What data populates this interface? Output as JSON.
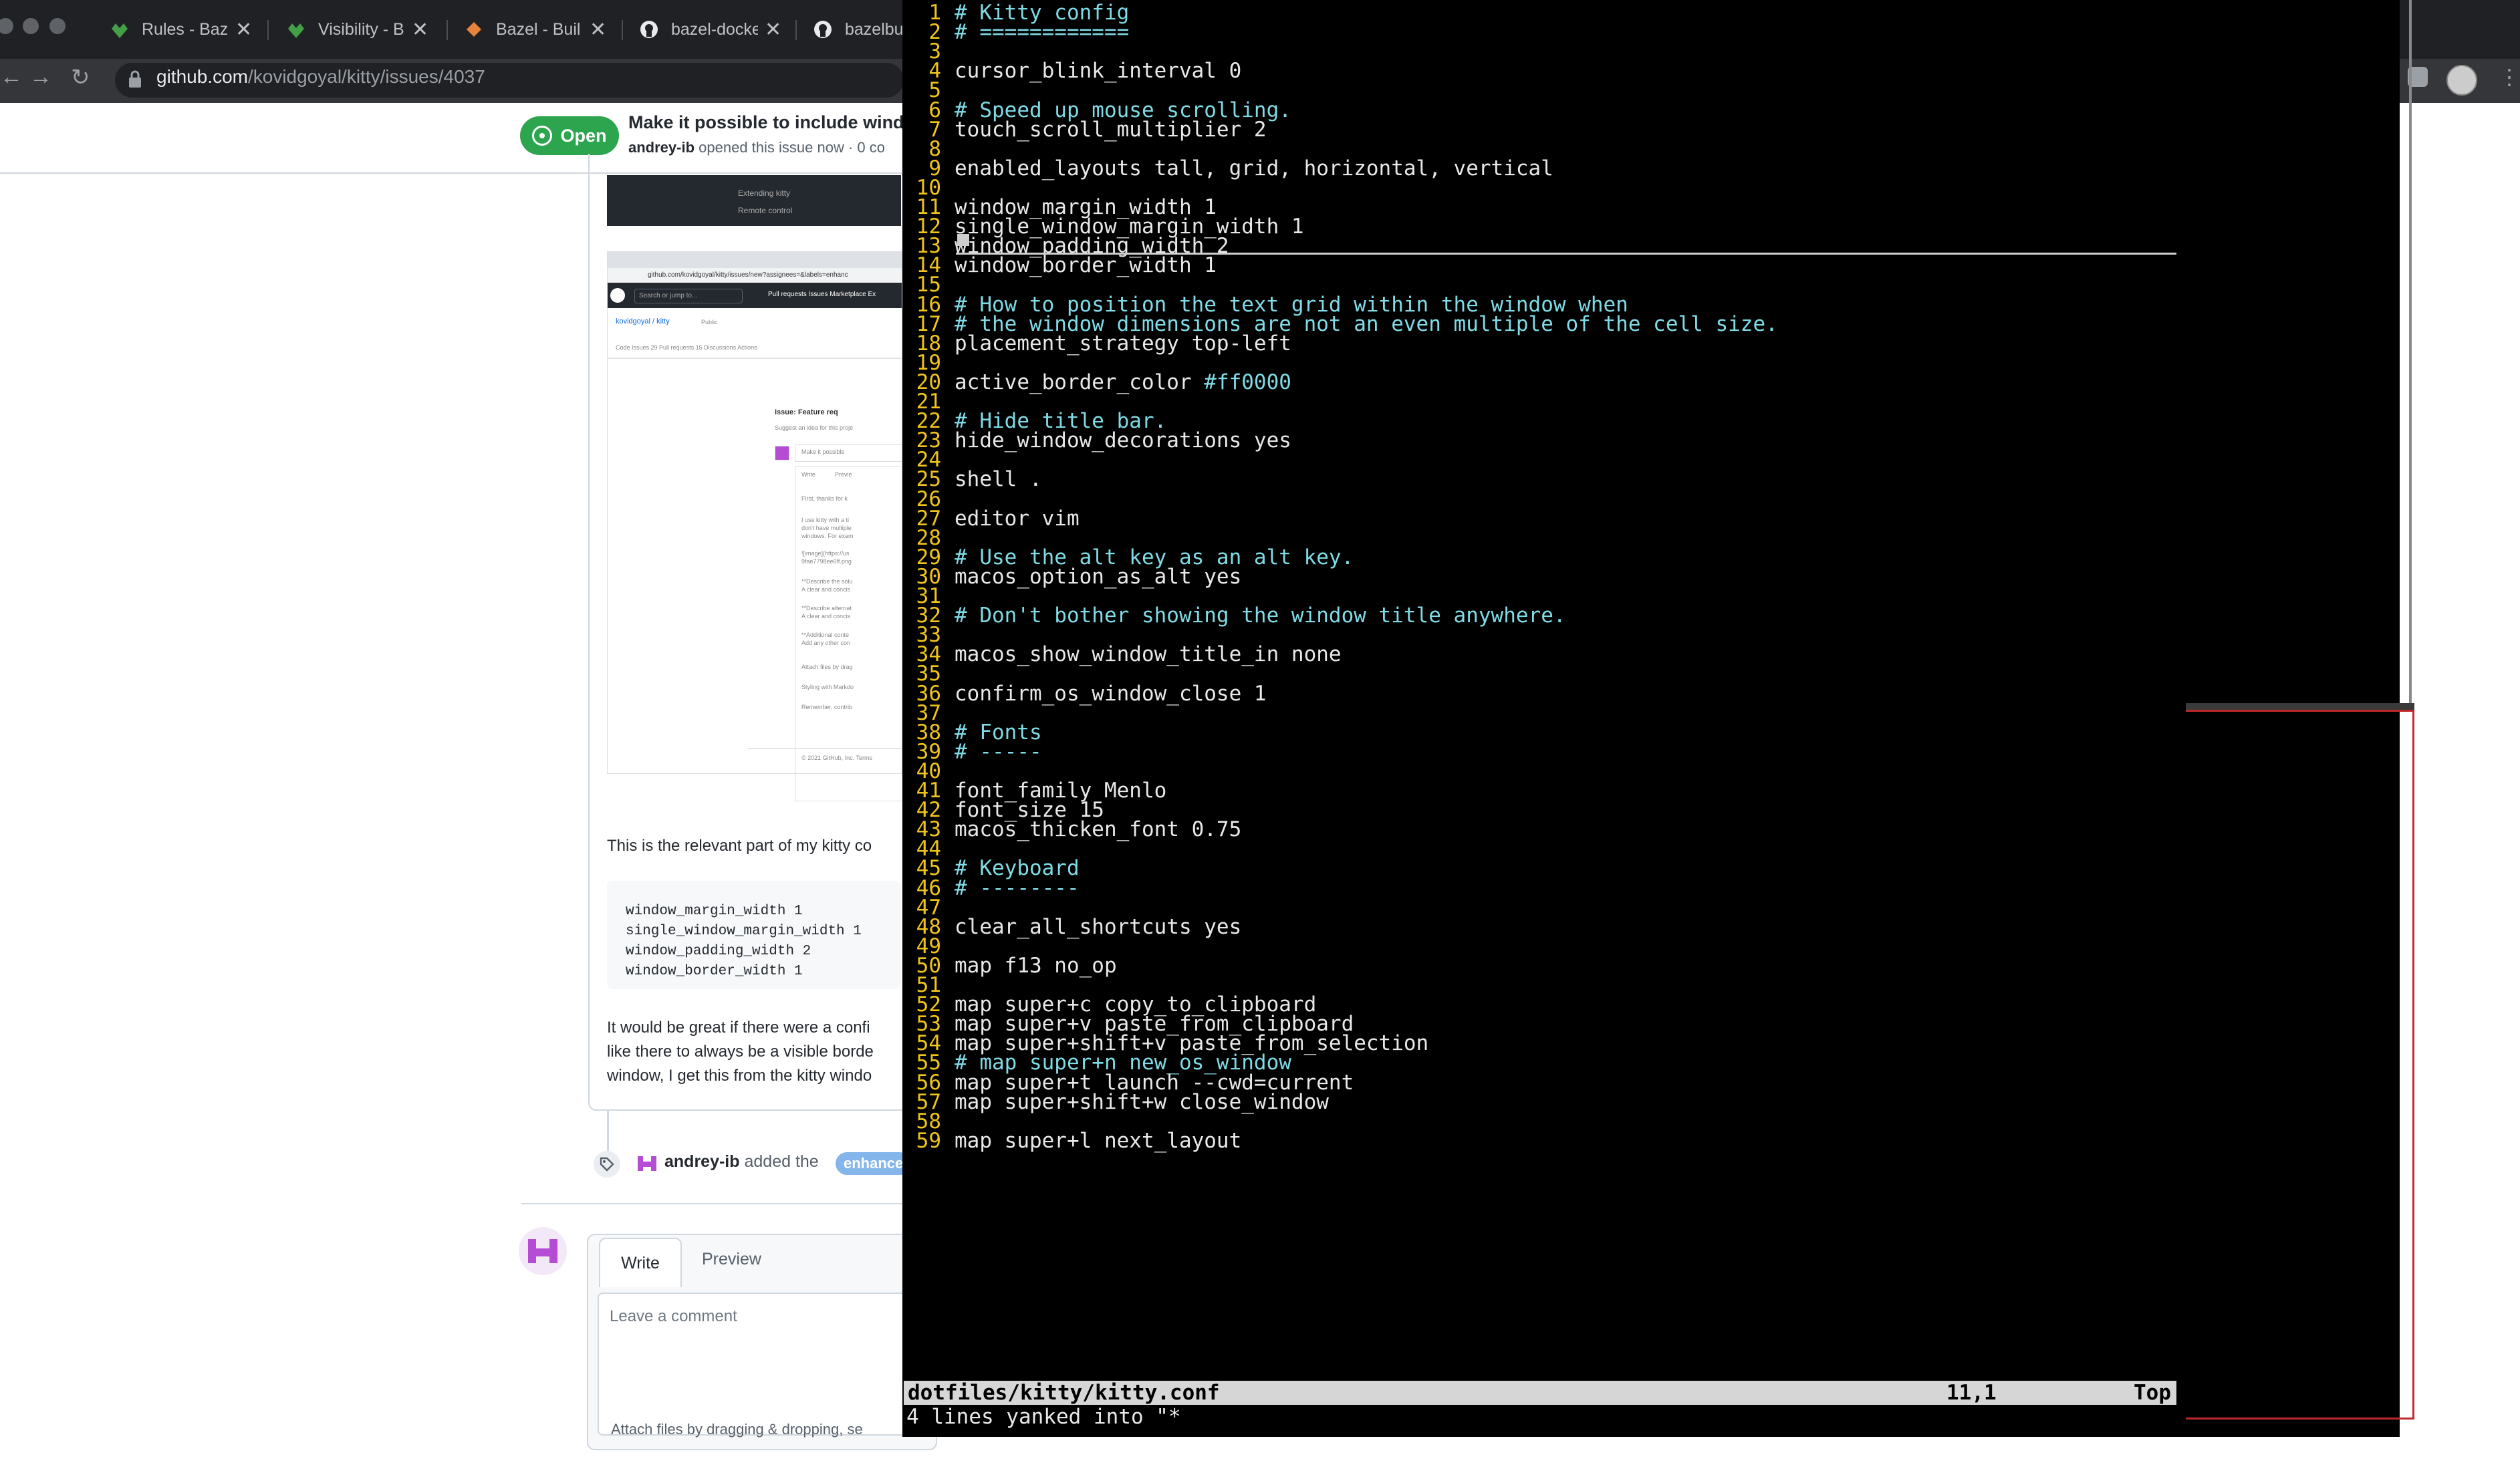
{
  "browser": {
    "tabs": [
      {
        "title": "Rules - Baze",
        "icon": "bazel-leaf-icon"
      },
      {
        "title": "Visibility - B",
        "icon": "bazel-leaf-icon"
      },
      {
        "title": "Bazel - Buil",
        "icon": "bazel-icon"
      },
      {
        "title": "bazel-docke",
        "icon": "github-icon"
      },
      {
        "title": "bazelbu",
        "icon": "github-icon"
      }
    ],
    "close_glyph": "✕",
    "url_host": "github.com",
    "url_path": "/kovidgoyal/kitty/issues/4037"
  },
  "issue": {
    "state": "Open",
    "title": "Make it possible to include windo",
    "author": "andrey-ib",
    "meta_rest": " opened this issue now · 0 co",
    "relevant_text": "This is the relevant part of my kitty co",
    "code_lines": [
      "window_margin_width 1",
      "single_window_margin_width 1",
      "window_padding_width 2",
      "window_border_width 1"
    ],
    "para_lines": [
      "It would be great if there were a confi",
      "like there to always be a visible borde",
      "window, I get this from the kitty windo"
    ],
    "label_event_actor": "andrey-ib",
    "label_event_action": " added the ",
    "label_name": "enhance",
    "write_tab": "Write",
    "preview_tab": "Preview",
    "comment_placeholder": "Leave a comment",
    "attach_text": "Attach files by dragging & dropping, se"
  },
  "embedded_screenshot": {
    "dark_items": [
      "Extending kitty",
      "Remote control"
    ],
    "url": "github.com/kovidgoyal/kitty/issues/new?assignees=&labels=enhanc",
    "search": "Search or jump to...",
    "nav": "Pull requests  Issues  Marketplace  Ex",
    "repo": "kovidgoyal / kitty",
    "repo_badge": "Public",
    "repo_tabs": "Code   Issues 29   Pull requests 15   Discussions   Actions",
    "issue_head": "Issue: Feature req",
    "issue_sub": "Suggest an idea for this proje",
    "title_field": "Make it possible",
    "write": "Write",
    "preview": "Previe",
    "body_lines": [
      "First, thanks for k",
      "I use kitty with a ti",
      "don't have multiple",
      "windows. For exam",
      "![image](https://us",
      "9fae7798ee6ff.png",
      "**Describe the solu",
      "A clear and concis",
      "**Describe alternat",
      "A clear and concis",
      "**Additional conte",
      "Add any other con"
    ],
    "attach": "Attach files by drag",
    "styling": "Styling with Markdo",
    "remember": "Remember, contrib",
    "footer": "© 2021 GitHub, Inc.        Terms"
  },
  "terminal": {
    "lines": [
      {
        "n": "1",
        "t": "# Kitty config",
        "k": "cm"
      },
      {
        "n": "2",
        "t": "# ============",
        "k": "cm"
      },
      {
        "n": "3",
        "t": "",
        "k": "p"
      },
      {
        "n": "4",
        "t": "cursor_blink_interval 0",
        "k": "p"
      },
      {
        "n": "5",
        "t": "",
        "k": "p"
      },
      {
        "n": "6",
        "t": "# Speed up mouse scrolling.",
        "k": "cm"
      },
      {
        "n": "7",
        "t": "touch_scroll_multiplier 2",
        "k": "p"
      },
      {
        "n": "8",
        "t": "",
        "k": "p"
      },
      {
        "n": "9",
        "t": "enabled_layouts tall, grid, horizontal, vertical",
        "k": "p"
      },
      {
        "n": "10",
        "t": "",
        "k": "p"
      },
      {
        "n": "11",
        "t": "window_margin_width 1",
        "k": "p"
      },
      {
        "n": "12",
        "t": "single_window_margin_width 1",
        "k": "p"
      },
      {
        "n": "13",
        "t": "window_padding_width 2",
        "k": "p"
      },
      {
        "n": "14",
        "t": "window_border_width 1",
        "k": "p"
      },
      {
        "n": "15",
        "t": "",
        "k": "p"
      },
      {
        "n": "16",
        "t": "# How to position the text grid within the window when",
        "k": "cm"
      },
      {
        "n": "17",
        "t": "# the window dimensions are not an even multiple of the cell size.",
        "k": "cm"
      },
      {
        "n": "18",
        "t": "placement_strategy top-left",
        "k": "p"
      },
      {
        "n": "19",
        "t": "",
        "k": "p"
      },
      {
        "n": "20",
        "t": "active_border_color ",
        "k": "p",
        "hex": "#ff0000"
      },
      {
        "n": "21",
        "t": "",
        "k": "p"
      },
      {
        "n": "22",
        "t": "# Hide title bar.",
        "k": "cm"
      },
      {
        "n": "23",
        "t": "hide_window_decorations yes",
        "k": "p"
      },
      {
        "n": "24",
        "t": "",
        "k": "p"
      },
      {
        "n": "25",
        "t": "shell .",
        "k": "p"
      },
      {
        "n": "26",
        "t": "",
        "k": "p"
      },
      {
        "n": "27",
        "t": "editor vim",
        "k": "p"
      },
      {
        "n": "28",
        "t": "",
        "k": "p"
      },
      {
        "n": "29",
        "t": "# Use the alt key as an alt key.",
        "k": "cm"
      },
      {
        "n": "30",
        "t": "macos_option_as_alt yes",
        "k": "p"
      },
      {
        "n": "31",
        "t": "",
        "k": "p"
      },
      {
        "n": "32",
        "t": "# Don't bother showing the window title anywhere.",
        "k": "cm"
      },
      {
        "n": "33",
        "t": "",
        "k": "p"
      },
      {
        "n": "34",
        "t": "macos_show_window_title_in none",
        "k": "p"
      },
      {
        "n": "35",
        "t": "",
        "k": "p"
      },
      {
        "n": "36",
        "t": "confirm_os_window_close 1",
        "k": "p"
      },
      {
        "n": "37",
        "t": "",
        "k": "p"
      },
      {
        "n": "38",
        "t": "# Fonts",
        "k": "cm"
      },
      {
        "n": "39",
        "t": "# -----",
        "k": "cm"
      },
      {
        "n": "40",
        "t": "",
        "k": "p"
      },
      {
        "n": "41",
        "t": "font_family Menlo",
        "k": "p"
      },
      {
        "n": "42",
        "t": "font_size 15",
        "k": "p"
      },
      {
        "n": "43",
        "t": "macos_thicken_font 0.75",
        "k": "p"
      },
      {
        "n": "44",
        "t": "",
        "k": "p"
      },
      {
        "n": "45",
        "t": "# Keyboard",
        "k": "cm"
      },
      {
        "n": "46",
        "t": "# --------",
        "k": "cm"
      },
      {
        "n": "47",
        "t": "",
        "k": "p"
      },
      {
        "n": "48",
        "t": "clear_all_shortcuts yes",
        "k": "p"
      },
      {
        "n": "49",
        "t": "",
        "k": "p"
      },
      {
        "n": "50",
        "t": "map f13 no_op",
        "k": "p"
      },
      {
        "n": "51",
        "t": "",
        "k": "p"
      },
      {
        "n": "52",
        "t": "map super+c copy_to_clipboard",
        "k": "p"
      },
      {
        "n": "53",
        "t": "map super+v paste_from_clipboard",
        "k": "p"
      },
      {
        "n": "54",
        "t": "map super+shift+v paste_from_selection",
        "k": "p"
      },
      {
        "n": "55",
        "t": "# map super+n new_os_window",
        "k": "cm"
      },
      {
        "n": "56",
        "t": "map super+t launch --cwd=current",
        "k": "p"
      },
      {
        "n": "57",
        "t": "map super+shift+w close_window",
        "k": "p"
      },
      {
        "n": "58",
        "t": "",
        "k": "p"
      },
      {
        "n": "59",
        "t": "map super+l next_layout",
        "k": "p"
      }
    ],
    "status_file": "dotfiles/kitty/kitty.conf",
    "status_pos": "11,1",
    "status_scroll": "Top",
    "cmdline": "4 lines yanked into \"*"
  },
  "colors": {
    "line_number": "#f0c419",
    "comment": "#7fdbe6",
    "border_active": "#c0282c",
    "open_badge": "#2da44e"
  }
}
